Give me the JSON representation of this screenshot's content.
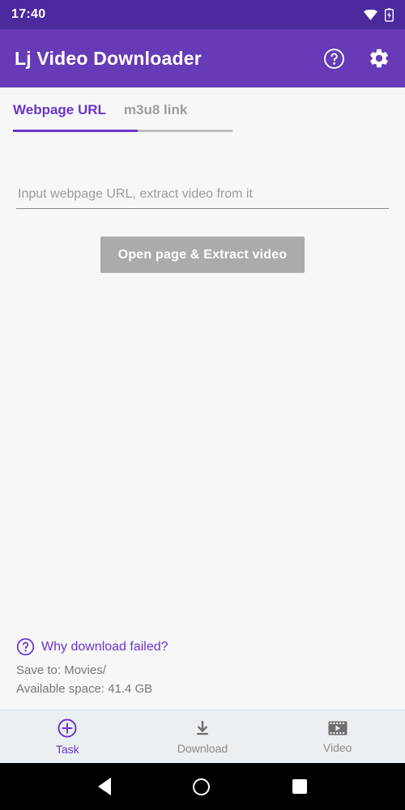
{
  "status_bar": {
    "time": "17:40",
    "icons": [
      "wifi-icon",
      "battery-charging-icon"
    ],
    "background": "#4B2A9E"
  },
  "app_bar": {
    "title": "Lj Video Downloader",
    "background": "#673AB7",
    "actions": [
      {
        "name": "help-icon",
        "label": "Help"
      },
      {
        "name": "gear-icon",
        "label": "Settings"
      }
    ]
  },
  "tabs": {
    "items": [
      {
        "label": "Webpage URL",
        "active": true
      },
      {
        "label": "m3u8 link",
        "active": false
      }
    ],
    "active_color": "#6A35CE",
    "inactive_color": "#9E9E9E"
  },
  "main": {
    "url_input": {
      "value": "",
      "placeholder": "Input webpage URL, extract video from it"
    },
    "extract_button": {
      "label": "Open page & Extract video",
      "enabled": false,
      "background": "#ABABAB"
    }
  },
  "footer": {
    "why_failed_label": "Why download failed?",
    "save_to": "Save to: Movies/",
    "available_space": "Available space: 41.4 GB",
    "link_color": "#6A35CE"
  },
  "bottom_nav": {
    "items": [
      {
        "label": "Task",
        "icon": "plus-circle-icon",
        "active": true
      },
      {
        "label": "Download",
        "icon": "download-icon",
        "active": false
      },
      {
        "label": "Video",
        "icon": "film-play-icon",
        "active": false
      }
    ],
    "background": "#ECEFF1"
  },
  "android_nav": {
    "buttons": [
      {
        "name": "back-button"
      },
      {
        "name": "home-button"
      },
      {
        "name": "recents-button"
      }
    ]
  }
}
